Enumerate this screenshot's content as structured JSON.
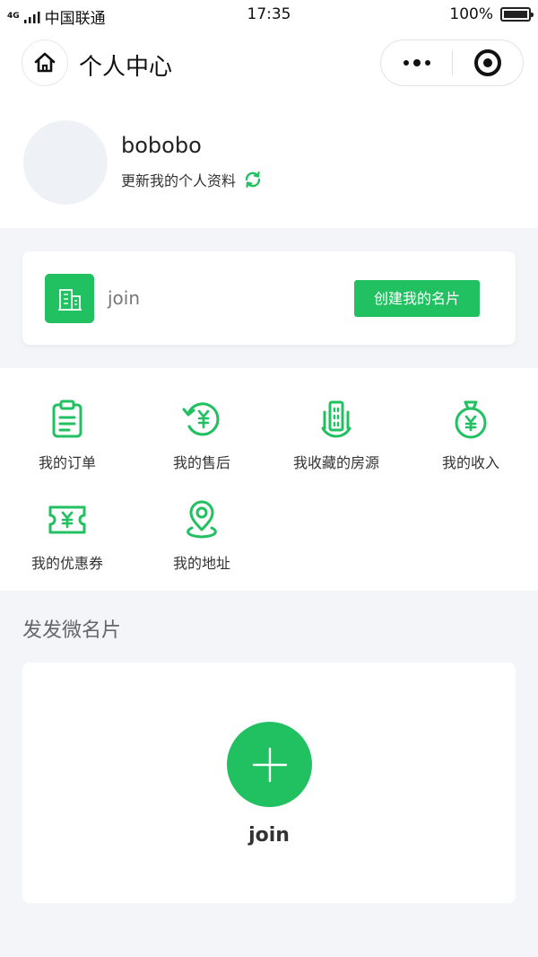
{
  "status_bar": {
    "network": "4G",
    "network_secondary": "4G",
    "carrier": "中国联通",
    "time": "17:35",
    "battery": "100%"
  },
  "nav": {
    "title": "个人中心",
    "home_icon": "home-icon",
    "more_icon": "more-dots-icon",
    "close_icon": "target-close-icon"
  },
  "profile": {
    "username": "bobobo",
    "update_label": "更新我的个人资料",
    "refresh_icon": "refresh-icon"
  },
  "card": {
    "name": "join",
    "create_label": "创建我的名片",
    "icon": "building-icon"
  },
  "menu": {
    "items": [
      {
        "label": "我的订单",
        "icon": "clipboard-icon"
      },
      {
        "label": "我的售后",
        "icon": "refund-icon"
      },
      {
        "label": "我收藏的房源",
        "icon": "buildings-icon"
      },
      {
        "label": "我的收入",
        "icon": "money-bag-icon"
      },
      {
        "label": "我的优惠券",
        "icon": "coupon-icon"
      },
      {
        "label": "我的地址",
        "icon": "location-pin-icon"
      }
    ]
  },
  "section": {
    "title": "发发微名片",
    "join_label": "join",
    "add_icon": "plus-icon"
  },
  "colors": {
    "accent": "#21c061",
    "background": "#f3f5f8"
  }
}
